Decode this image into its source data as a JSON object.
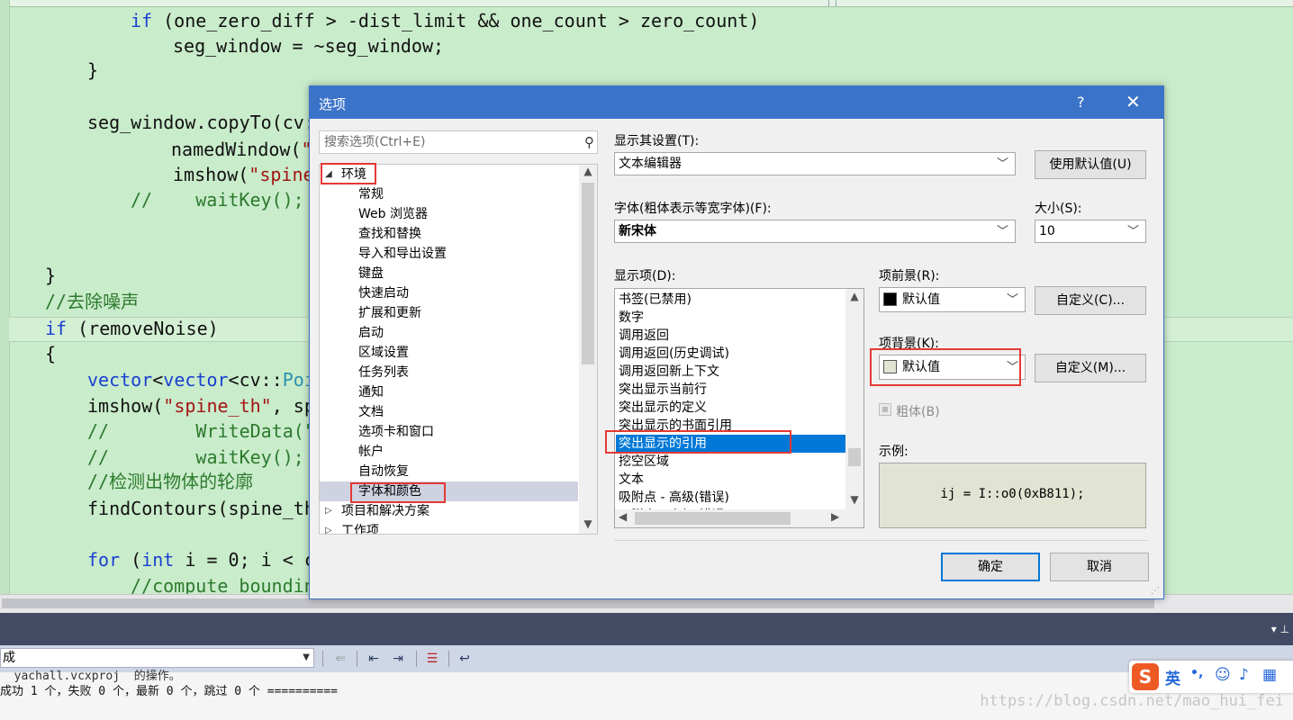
{
  "code": {
    "l1": {
      "kw": "if",
      "rest": " (one_zero_diff > -dist_limit && one_count > zero_count)"
    },
    "l2": "seg_window = ~seg_window;",
    "l3": "}",
    "l4": "seg_window.copyTo(cv:",
    "l5a": "namedWindow(",
    "l5b": "\"",
    "l6a": "imshow(",
    "l6b": "\"spine_",
    "l7a": "//    waitKey(); ",
    "l8": "}",
    "l9": "//去除噪声",
    "l10": {
      "kw": "if",
      "rest": " (removeNoise)"
    },
    "l11": "{",
    "l12": {
      "kw": "vector",
      "lt": "<",
      "kw2": "vector",
      "lt2": "<cv::",
      "ty": "Poi"
    },
    "l13": {
      "a": "imshow(",
      "s": "\"spine_th\"",
      "b": ", sp"
    },
    "l14": "//        WriteData(\"",
    "l15": "//        waitKey();",
    "l16": "//检测出物体的轮廓",
    "l17": "findContours(spine_th",
    "l18": {
      "kw1": "for",
      "a": " (",
      "kw2": "int",
      "b": " i = 0; i < c"
    },
    "l19": "//compute boundin"
  },
  "output": {
    "combo_value": "成",
    "line1": "  yachall.vcxproj  的操作。",
    "line2": "成功 1 个，失败 0 个，最新 0 个，跳过 0 个 ==========",
    "watermark": "https://blog.csdn.net/mao_hui_fei"
  },
  "ime": {
    "lang": "英",
    "punct": "•,"
  },
  "dialog": {
    "title": "选项",
    "help": "?",
    "close": "✕",
    "search_placeholder": "搜索选项(Ctrl+E)",
    "tree": [
      {
        "arrow": "◢",
        "label": "环境"
      },
      {
        "label": "常规"
      },
      {
        "label": "Web 浏览器"
      },
      {
        "label": "查找和替换"
      },
      {
        "label": "导入和导出设置"
      },
      {
        "label": "键盘"
      },
      {
        "label": "快速启动"
      },
      {
        "label": "扩展和更新"
      },
      {
        "label": "启动"
      },
      {
        "label": "区域设置"
      },
      {
        "label": "任务列表"
      },
      {
        "label": "通知"
      },
      {
        "label": "文档"
      },
      {
        "label": "选项卡和窗口"
      },
      {
        "label": "帐户"
      },
      {
        "label": "自动恢复"
      },
      {
        "label": "字体和颜色"
      },
      {
        "arrow": "▷",
        "label": "项目和解决方案"
      },
      {
        "arrow": "▷",
        "label": "工作项"
      }
    ],
    "show_settings_label": "显示其设置(T):",
    "show_settings_value": "文本编辑器",
    "use_defaults_button": "使用默认值(U)",
    "font_label": "字体(粗体表示等宽字体)(F):",
    "font_value": "新宋体",
    "size_label": "大小(S):",
    "size_value": "10",
    "display_items_label": "显示项(D):",
    "display_items": [
      "书签(已禁用)",
      "数字",
      "调用返回",
      "调用返回(历史调试)",
      "调用返回新上下文",
      "突出显示当前行",
      "突出显示的定义",
      "突出显示的书面引用",
      "突出显示的引用",
      "挖空区域",
      "文本",
      "吸附点 - 高级(错误)",
      "吸附点 - 高级(错误)"
    ],
    "item_foreground_label": "项前景(R):",
    "item_foreground_value": "默认值",
    "item_foreground_color": "#000000",
    "custom_fg_button": "自定义(C)...",
    "item_background_label": "项背景(K):",
    "item_background_value": "默认值",
    "item_background_color": "#e1e4d3",
    "custom_bg_button": "自定义(M)...",
    "bold_label": "粗体(B)",
    "sample_label": "示例:",
    "sample_text": "ij = I::o0(0xB811);",
    "ok_button": "确定",
    "cancel_button": "取消"
  },
  "colors": {
    "accent": "#3b73c8",
    "selection": "#0078d7",
    "annotation": "#e53935",
    "editor_bg": "#c9eccb"
  }
}
